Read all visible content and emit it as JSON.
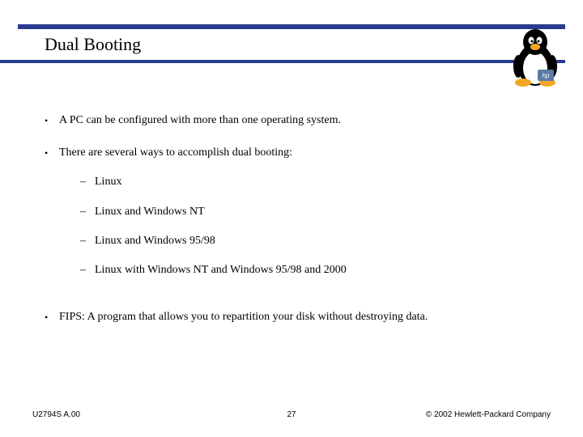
{
  "title": "Dual Booting",
  "bullets": {
    "b0": "A PC can be configured with more than one operating system.",
    "b1": "There are several ways to accomplish dual booting:",
    "sub": {
      "s0": "Linux",
      "s1": "Linux and Windows NT",
      "s2": "Linux and Windows 95/98",
      "s3": "Linux with Windows NT and Windows 95/98 and 2000"
    },
    "b2": "FIPS: A program that allows you  to repartition your disk without destroying data."
  },
  "footer": {
    "left": "U2794S A.00",
    "page": "27",
    "right": "© 2002 Hewlett-Packard Company"
  },
  "colors": {
    "accent": "#2a3b8f"
  },
  "mascot": {
    "name": "tux-penguin",
    "logo": "hp"
  }
}
